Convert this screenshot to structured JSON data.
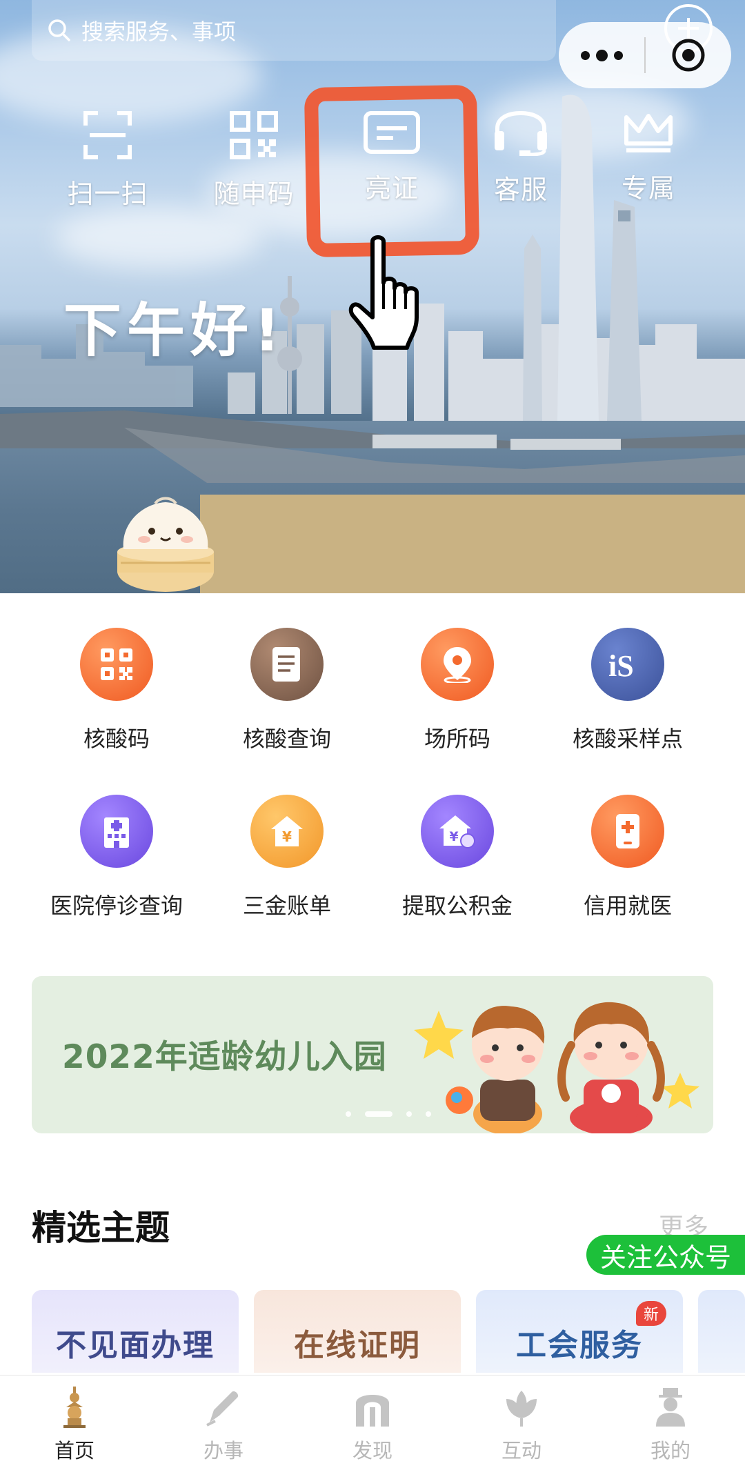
{
  "search": {
    "placeholder": "搜索服务、事项"
  },
  "quick_actions": [
    {
      "label": "扫一扫",
      "icon": "scan-icon"
    },
    {
      "label": "随申码",
      "icon": "qr-code-icon"
    },
    {
      "label": "亮证",
      "icon": "id-card-icon"
    },
    {
      "label": "客服",
      "icon": "headset-icon"
    },
    {
      "label": "专属",
      "icon": "crown-icon"
    }
  ],
  "greeting": "下午好!",
  "services": [
    {
      "label": "核酸码",
      "icon": "qr-code-icon",
      "color": "#f7703a"
    },
    {
      "label": "核酸查询",
      "icon": "document-icon",
      "color": "#8a6a58"
    },
    {
      "label": "场所码",
      "icon": "location-pin-icon",
      "color": "#f7703a"
    },
    {
      "label": "核酸采样点",
      "icon": "sampling-site-icon",
      "color": "#4b62b0"
    },
    {
      "label": "医院停诊查询",
      "icon": "hospital-icon",
      "color": "#7a5be8"
    },
    {
      "label": "三金账单",
      "icon": "yuan-house-icon",
      "color": "#f6a73a"
    },
    {
      "label": "提取公积金",
      "icon": "fund-withdraw-icon",
      "color": "#7a5be8"
    },
    {
      "label": "信用就医",
      "icon": "medical-phone-icon",
      "color": "#f7703a"
    }
  ],
  "banner": {
    "text": "2022年适龄幼儿入园"
  },
  "featured": {
    "title": "精选主题",
    "more": "更多",
    "follow": "关注公众号",
    "cards": [
      {
        "label": "不见面办理",
        "color": "#3f4a8c"
      },
      {
        "label": "在线证明",
        "color": "#8b5a3c"
      },
      {
        "label": "工会服务",
        "color": "#2f5fa0"
      }
    ],
    "new_badge": "新"
  },
  "tabs": [
    {
      "label": "首页",
      "icon": "pagoda-icon",
      "active": true
    },
    {
      "label": "办事",
      "icon": "pen-icon",
      "active": false
    },
    {
      "label": "发现",
      "icon": "arch-icon",
      "active": false
    },
    {
      "label": "互动",
      "icon": "magnolia-icon",
      "active": false
    },
    {
      "label": "我的",
      "icon": "person-icon",
      "active": false
    }
  ]
}
